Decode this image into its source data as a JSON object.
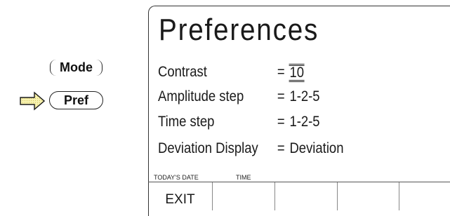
{
  "front_panel": {
    "mode_button": "Mode",
    "pref_button": "Pref",
    "pointer_icon": "right-arrow-icon"
  },
  "screen": {
    "title": "Preferences",
    "settings": [
      {
        "label": "Contrast",
        "equals": "=",
        "value": "10"
      },
      {
        "label": "Amplitude step",
        "equals": "=",
        "value": "1-2-5"
      },
      {
        "label": "Time step",
        "equals": "=",
        "value": "1-2-5"
      },
      {
        "label": "Deviation Display",
        "equals": "=",
        "value": "Deviation"
      }
    ],
    "status": {
      "date_label": "TODAY'S DATE",
      "time_label": "TIME"
    },
    "softkeys": [
      "EXIT",
      "",
      "",
      "",
      ""
    ]
  },
  "colors": {
    "arrow_fill": "#f5f0a0",
    "text": "#1a1a1a"
  }
}
